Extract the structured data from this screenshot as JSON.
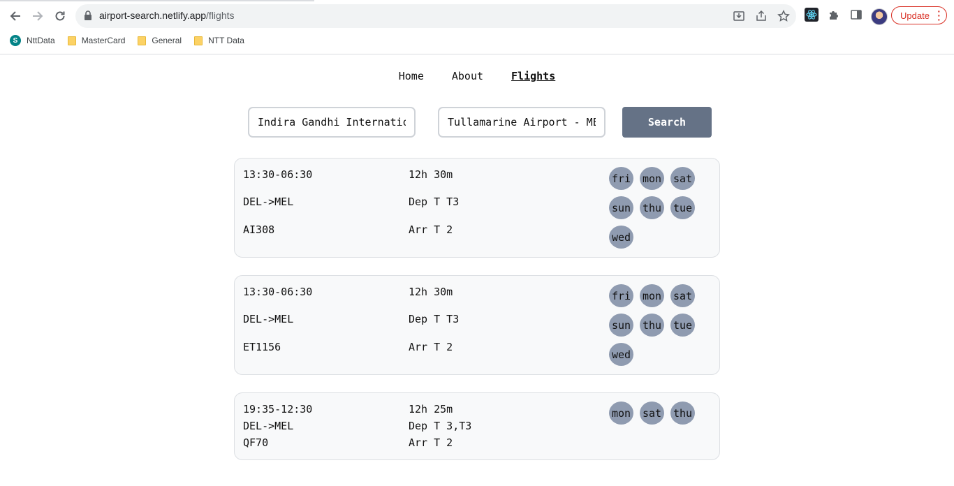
{
  "browser": {
    "url_host": "airport-search.netlify.app",
    "url_path": "/flights",
    "update_label": "Update",
    "bookmarks": [
      {
        "label": "NttData",
        "icon": "sharepoint-icon"
      },
      {
        "label": "MasterCard",
        "icon": "folder-icon"
      },
      {
        "label": "General",
        "icon": "folder-icon"
      },
      {
        "label": "NTT Data",
        "icon": "folder-icon"
      }
    ]
  },
  "nav": {
    "home": "Home",
    "about": "About",
    "flights": "Flights"
  },
  "search": {
    "from_value": "Indira Gandhi International Airport - DEL",
    "to_value": "Tullamarine Airport - MEL",
    "button_label": "Search"
  },
  "flights": [
    {
      "time": "13:30-06:30",
      "route": "DEL->MEL",
      "flight_no": "AI308",
      "duration": "12h 30m",
      "departure": "Dep T T3",
      "arrival": "Arr T 2",
      "days": [
        "fri",
        "mon",
        "sat",
        "sun",
        "thu",
        "tue",
        "wed"
      ]
    },
    {
      "time": "13:30-06:30",
      "route": "DEL->MEL",
      "flight_no": "ET1156",
      "duration": "12h 30m",
      "departure": "Dep T T3",
      "arrival": "Arr T 2",
      "days": [
        "fri",
        "mon",
        "sat",
        "sun",
        "thu",
        "tue",
        "wed"
      ]
    },
    {
      "time": "19:35-12:30",
      "route": "DEL->MEL",
      "flight_no": "QF70",
      "duration": "12h 25m",
      "departure": "Dep T 3,T3",
      "arrival": "Arr T 2",
      "days": [
        "mon",
        "sat",
        "thu"
      ]
    }
  ]
}
